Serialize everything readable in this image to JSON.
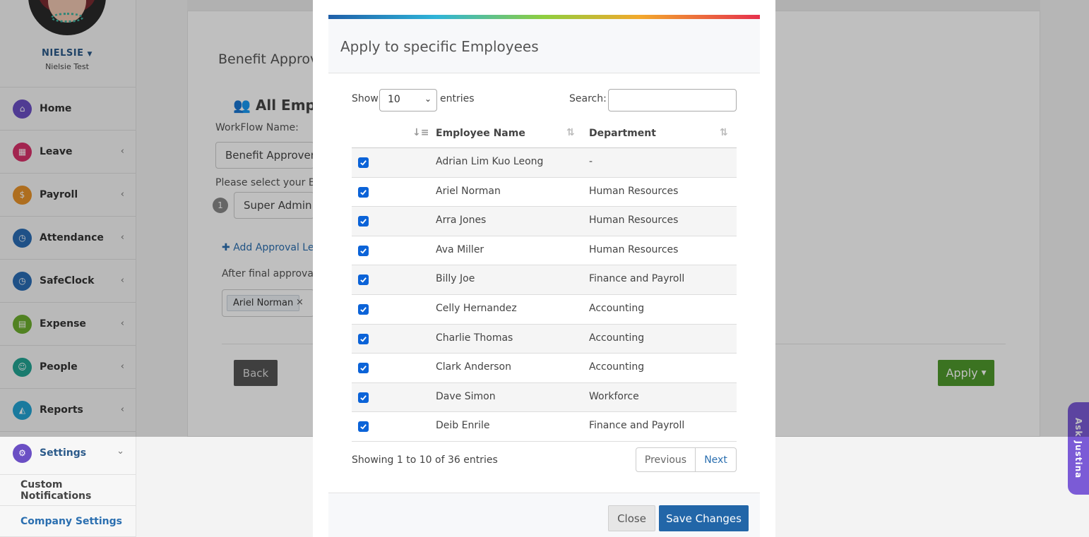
{
  "profile": {
    "name": "NIELSIE",
    "subtitle": "Nielsie Test"
  },
  "sidebar": {
    "items": [
      {
        "label": "Home",
        "icon": "home-icon",
        "color": "#6b4fc4"
      },
      {
        "label": "Leave",
        "icon": "calendar-icon",
        "color": "#d9306a"
      },
      {
        "label": "Payroll",
        "icon": "payroll-icon",
        "color": "#e8932a"
      },
      {
        "label": "Attendance",
        "icon": "clock-icon",
        "color": "#2a6db5"
      },
      {
        "label": "SafeClock",
        "icon": "safeclock-icon",
        "color": "#2a6db5"
      },
      {
        "label": "Expense",
        "icon": "receipt-icon",
        "color": "#6cae2e"
      },
      {
        "label": "People",
        "icon": "people-icon",
        "color": "#22a593"
      },
      {
        "label": "Reports",
        "icon": "chart-icon",
        "color": "#23a3d3"
      },
      {
        "label": "Settings",
        "icon": "gear-icon",
        "color": "#6b4fc4"
      }
    ],
    "sub_items": [
      "Custom Notifications",
      "Company Settings"
    ]
  },
  "page": {
    "section_title": "Benefit Approv",
    "group_heading": "All Emplo",
    "workflow_label": "WorkFlow Name:",
    "workflow_value": "Benefit Approver",
    "select_label": "Please select your Be",
    "level_number": "1",
    "approver_value": "Super Admin",
    "add_level": "Add Approval Lev",
    "after_final": "After final approval,",
    "tag": "Ariel Norman",
    "tag_remove": "×",
    "back": "Back",
    "apply": "Apply"
  },
  "ask": {
    "label": "Ask Justina",
    "color": "#7b5bd6"
  },
  "modal": {
    "title": "Apply to specific Employees",
    "show_label": "Show",
    "entries_value": "10",
    "entries_label": "entries",
    "search_label": "Search:",
    "columns": [
      "Employee Name",
      "Department"
    ],
    "rows": [
      {
        "name": "Adrian Lim Kuo Leong",
        "dept": "-"
      },
      {
        "name": "Ariel Norman",
        "dept": "Human Resources"
      },
      {
        "name": "Arra Jones",
        "dept": "Human Resources"
      },
      {
        "name": "Ava Miller",
        "dept": "Human Resources"
      },
      {
        "name": "Billy Joe",
        "dept": "Finance and Payroll"
      },
      {
        "name": "Celly Hernandez",
        "dept": "Accounting"
      },
      {
        "name": "Charlie Thomas",
        "dept": "Accounting"
      },
      {
        "name": "Clark Anderson",
        "dept": "Accounting"
      },
      {
        "name": "Dave Simon",
        "dept": "Workforce"
      },
      {
        "name": "Deib Enrile",
        "dept": "Finance and Payroll"
      }
    ],
    "showing": "Showing 1 to 10 of 36 entries",
    "previous": "Previous",
    "next": "Next",
    "close": "Close",
    "save": "Save Changes",
    "accent": "#2266a8",
    "checkbox_color": "#0b63d8"
  }
}
